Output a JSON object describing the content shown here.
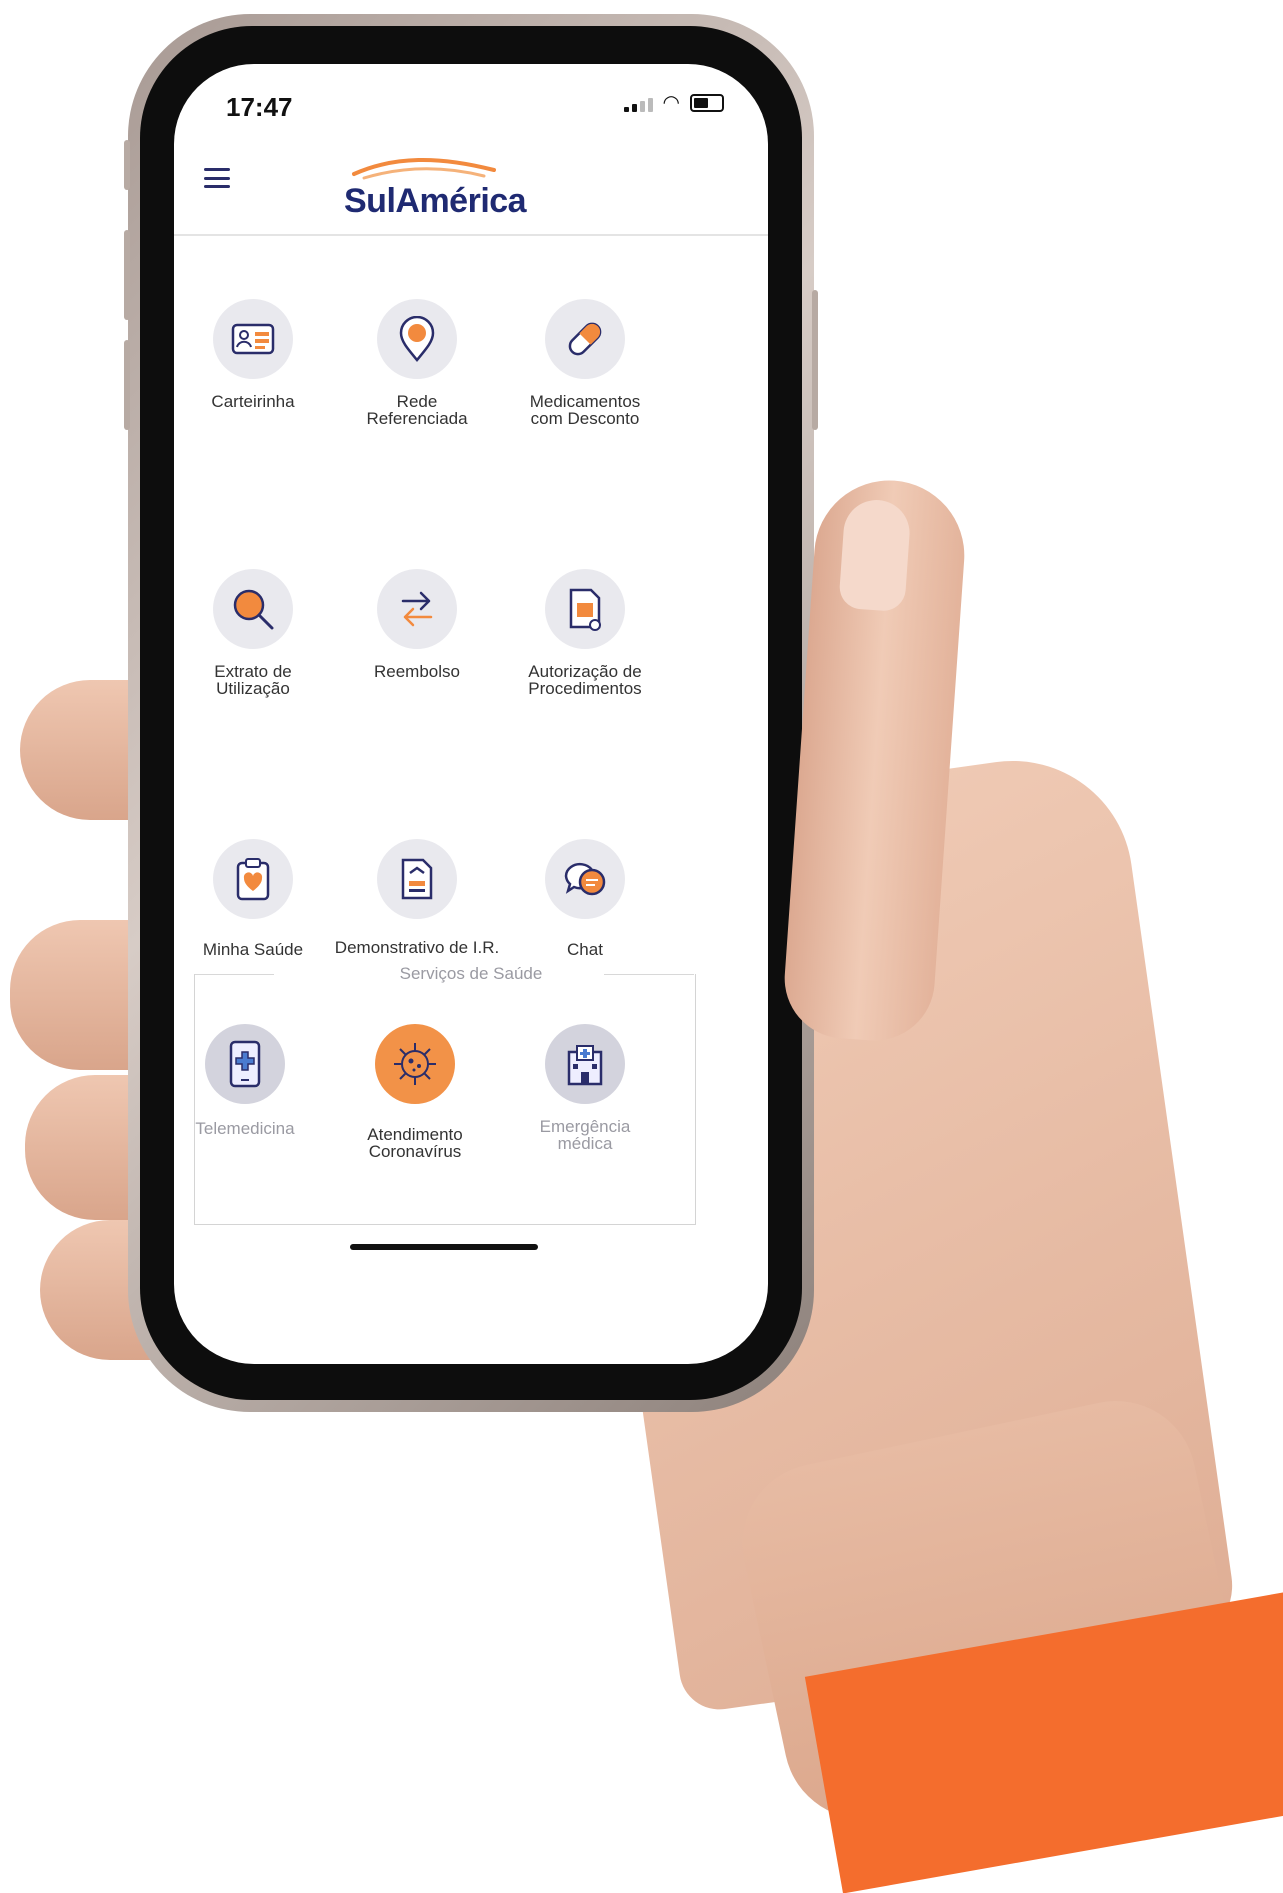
{
  "status_bar": {
    "time": "17:47"
  },
  "header": {
    "brand": "SulAmérica"
  },
  "menu": {
    "row1": [
      {
        "label_lines": [
          "Carteirinha"
        ],
        "icon": "id-card-icon"
      },
      {
        "label_lines": [
          "Rede",
          "Referenciada"
        ],
        "icon": "map-pin-icon"
      },
      {
        "label_lines": [
          "Medicamentos",
          "com Desconto"
        ],
        "icon": "pill-icon"
      }
    ],
    "row2": [
      {
        "label_lines": [
          "Extrato de",
          "Utilização"
        ],
        "icon": "search-icon"
      },
      {
        "label_lines": [
          "Reembolso"
        ],
        "icon": "transfer-arrows-icon"
      },
      {
        "label_lines": [
          "Autorização de",
          "Procedimentos"
        ],
        "icon": "document-check-icon"
      }
    ],
    "row3": [
      {
        "label_lines": [
          "Minha Saúde"
        ],
        "icon": "clipboard-heart-icon"
      },
      {
        "label_lines": [
          "Demonstrativo de I.R."
        ],
        "icon": "document-graph-icon"
      },
      {
        "label_lines": [
          "Chat"
        ],
        "icon": "chat-bubbles-icon"
      }
    ]
  },
  "services": {
    "title": "Serviços de Saúde",
    "items": [
      {
        "label_lines": [
          "Telemedicina"
        ],
        "icon": "phone-medical-icon",
        "active": false
      },
      {
        "label_lines": [
          "Atendimento",
          "Coronavírus"
        ],
        "icon": "virus-icon",
        "active": true
      },
      {
        "label_lines": [
          "Emergência",
          "médica"
        ],
        "icon": "hospital-icon",
        "active": false
      }
    ]
  },
  "colors": {
    "brand_blue": "#1f2a72",
    "accent_orange": "#f29248",
    "icon_bg": "#e9e9ee",
    "sleeve_orange": "#f46d2d"
  }
}
